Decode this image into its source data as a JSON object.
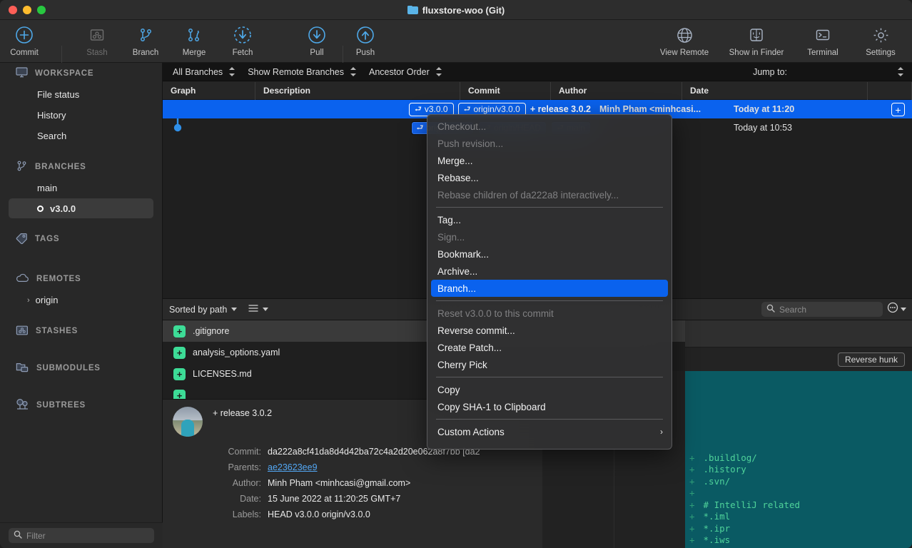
{
  "window": {
    "title": "fluxstore-woo (Git)",
    "folder_icon": "folder-icon"
  },
  "toolbar": {
    "left_buttons": [
      {
        "label": "Commit",
        "icon": "commit-plus-circle-icon",
        "disabled": false
      },
      {
        "label": "Stash",
        "icon": "stash-box-icon",
        "disabled": true
      },
      {
        "label": "Branch",
        "icon": "branch-icon",
        "disabled": false
      },
      {
        "label": "Merge",
        "icon": "merge-icon",
        "disabled": false
      },
      {
        "label": "Fetch",
        "icon": "fetch-dashed-circle-down-icon",
        "disabled": false
      },
      {
        "label": "Pull",
        "icon": "pull-circle-down-icon",
        "disabled": false
      },
      {
        "label": "Push",
        "icon": "push-circle-up-icon",
        "disabled": false
      }
    ],
    "right_buttons": [
      {
        "label": "View Remote",
        "icon": "globe-icon"
      },
      {
        "label": "Show in Finder",
        "icon": "finder-icon"
      },
      {
        "label": "Terminal",
        "icon": "terminal-icon"
      },
      {
        "label": "Settings",
        "icon": "gear-icon"
      }
    ]
  },
  "filterbar": {
    "branches_filter": "All Branches",
    "remote_filter": "Show Remote Branches",
    "order_filter": "Ancestor Order",
    "jump_to": "Jump to:"
  },
  "sidebar": {
    "sections": [
      {
        "title": "WORKSPACE",
        "icon": "monitor-icon",
        "items": [
          {
            "label": "File status",
            "selected": false
          },
          {
            "label": "History",
            "selected": false
          },
          {
            "label": "Search",
            "selected": false
          }
        ]
      },
      {
        "title": "BRANCHES",
        "icon": "branch-icon",
        "items": [
          {
            "label": "main",
            "selected": false
          },
          {
            "label": "v3.0.0",
            "selected": true,
            "bullet": "current-branch-dot"
          }
        ]
      },
      {
        "title": "TAGS",
        "icon": "tag-icon",
        "items": []
      },
      {
        "title": "REMOTES",
        "icon": "cloud-icon",
        "items": [
          {
            "label": "origin",
            "selected": false,
            "chevron": "chevron-right-icon"
          }
        ]
      },
      {
        "title": "STASHES",
        "icon": "stash-box-icon",
        "items": []
      },
      {
        "title": "SUBMODULES",
        "icon": "submodule-folders-icon",
        "items": []
      },
      {
        "title": "SUBTREES",
        "icon": "subtree-trees-icon",
        "items": []
      }
    ],
    "filter_placeholder": "Filter"
  },
  "commit_table": {
    "columns": [
      "Graph",
      "Description",
      "Commit",
      "Author",
      "Date"
    ],
    "rows": [
      {
        "selected": true,
        "refs": [
          "v3.0.0",
          "origin/v3.0.0"
        ],
        "message": "+ release 3.0.2",
        "author": "Minh Pham <minhcasi...",
        "date": "Today at 11:20",
        "add_button": "+"
      },
      {
        "selected": false,
        "refs": [
          "origin/main",
          "origin/HEAD",
          "main"
        ],
        "message": "",
        "author": "",
        "date": "Today at 10:53",
        "add_button": ""
      }
    ]
  },
  "files_pane": {
    "sort_label": "Sorted by path",
    "view_icon": "list-view-icon",
    "files": [
      {
        "name": ".gitignore",
        "status": "added",
        "selected": true
      },
      {
        "name": "analysis_options.yaml",
        "status": "added",
        "selected": false
      },
      {
        "name": "LICENSES.md",
        "status": "added",
        "selected": false
      },
      {
        "name": "",
        "status": "added",
        "selected": false
      }
    ]
  },
  "commit_detail": {
    "title": "+ release 3.0.2",
    "avatar": "user-avatar",
    "fields": [
      {
        "key": "Commit:",
        "value": "da222a8cf41da8d4d42ba72c4a2d20e062a8f7bb [da2",
        "link": false
      },
      {
        "key": "Parents:",
        "value": "ae23623ee9",
        "link": true
      },
      {
        "key": "Author:",
        "value": "Minh Pham <minhcasi@gmail.com>",
        "link": false
      },
      {
        "key": "Date:",
        "value": "15 June 2022 at 11:20:25 GMT+7",
        "link": false
      },
      {
        "key": "Labels:",
        "value": "HEAD v3.0.0 origin/v3.0.0",
        "link": false
      }
    ]
  },
  "diff_pane": {
    "search_placeholder": "Search",
    "options_icon": "ellipsis-circle-icon",
    "reverse_hunk_label": "Reverse hunk",
    "lines": [
      {
        "sign": "+",
        "text": ".buildlog/"
      },
      {
        "sign": "+",
        "text": ".history"
      },
      {
        "sign": "+",
        "text": ".svn/"
      },
      {
        "sign": "+",
        "text": ""
      },
      {
        "sign": "+",
        "text": "# IntelliJ related"
      },
      {
        "sign": "+",
        "text": "*.iml"
      },
      {
        "sign": "+",
        "text": "*.ipr"
      },
      {
        "sign": "+",
        "text": "*.iws"
      }
    ]
  },
  "context_menu": {
    "items": [
      {
        "label": "Checkout...",
        "state": "disabled"
      },
      {
        "label": "Push revision...",
        "state": "disabled"
      },
      {
        "label": "Merge...",
        "state": "normal"
      },
      {
        "label": "Rebase...",
        "state": "normal"
      },
      {
        "label": "Rebase children of da222a8 interactively...",
        "state": "disabled"
      },
      {
        "separator": true
      },
      {
        "label": "Tag...",
        "state": "normal"
      },
      {
        "label": "Sign...",
        "state": "disabled"
      },
      {
        "label": "Bookmark...",
        "state": "normal"
      },
      {
        "label": "Archive...",
        "state": "normal"
      },
      {
        "label": "Branch...",
        "state": "highlighted"
      },
      {
        "separator": true
      },
      {
        "label": "Reset v3.0.0 to this commit",
        "state": "disabled"
      },
      {
        "label": "Reverse commit...",
        "state": "normal"
      },
      {
        "label": "Create Patch...",
        "state": "normal"
      },
      {
        "label": "Cherry Pick",
        "state": "normal"
      },
      {
        "separator": true
      },
      {
        "label": "Copy",
        "state": "normal"
      },
      {
        "label": "Copy SHA-1 to Clipboard",
        "state": "normal"
      },
      {
        "separator": true
      },
      {
        "label": "Custom Actions",
        "state": "normal",
        "submenu": "›"
      }
    ]
  },
  "colors": {
    "accent_blue": "#0a62ee",
    "icon_blue": "#4ea8e8",
    "added_green": "#3ddc97",
    "diff_bg": "#0a5a63",
    "diff_text": "#4fd39a"
  }
}
